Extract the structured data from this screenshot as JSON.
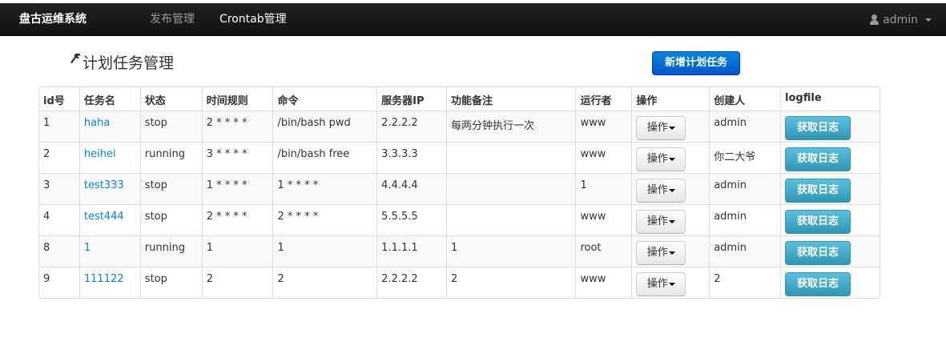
{
  "navbar": {
    "brand": "盘古运维系统",
    "links": [
      {
        "label": "发布管理",
        "active": false
      },
      {
        "label": "Crontab管理",
        "active": true
      }
    ],
    "user": "admin"
  },
  "page": {
    "title": "计划任务管理",
    "add_button": "新增计划任务"
  },
  "table": {
    "headers": [
      "id号",
      "任务名",
      "状态",
      "时间规则",
      "命令",
      "服务器IP",
      "功能备注",
      "运行者",
      "操作",
      "创建人",
      "logfile"
    ],
    "ops_label": "操作",
    "log_label": "获取日志",
    "rows": [
      {
        "id": "1",
        "name": "haha",
        "status": "stop",
        "rule": "2 * * * *",
        "command": "/bin/bash pwd",
        "ip": "2.2.2.2",
        "note": "每两分钟执行一次",
        "runner": "www",
        "creator": "admin"
      },
      {
        "id": "2",
        "name": "heihei",
        "status": "running",
        "rule": "3 * * * *",
        "command": "/bin/bash free",
        "ip": "3.3.3.3",
        "note": "",
        "runner": "www",
        "creator": "你二大爷"
      },
      {
        "id": "3",
        "name": "test333",
        "status": "stop",
        "rule": "1 * * * *",
        "command": "1 * * * *",
        "ip": "4.4.4.4",
        "note": "",
        "runner": "1",
        "creator": "admin"
      },
      {
        "id": "4",
        "name": "test444",
        "status": "stop",
        "rule": "2 * * * *",
        "command": "2 * * * *",
        "ip": "5.5.5.5",
        "note": "",
        "runner": "www",
        "creator": "admin"
      },
      {
        "id": "8",
        "name": "1",
        "status": "running",
        "rule": "1",
        "command": "1",
        "ip": "1.1.1.1",
        "note": "1",
        "runner": "root",
        "creator": "admin"
      },
      {
        "id": "9",
        "name": "111122",
        "status": "stop",
        "rule": "2",
        "command": "2",
        "ip": "2.2.2.2",
        "note": "2",
        "runner": "www",
        "creator": "2"
      }
    ]
  }
}
